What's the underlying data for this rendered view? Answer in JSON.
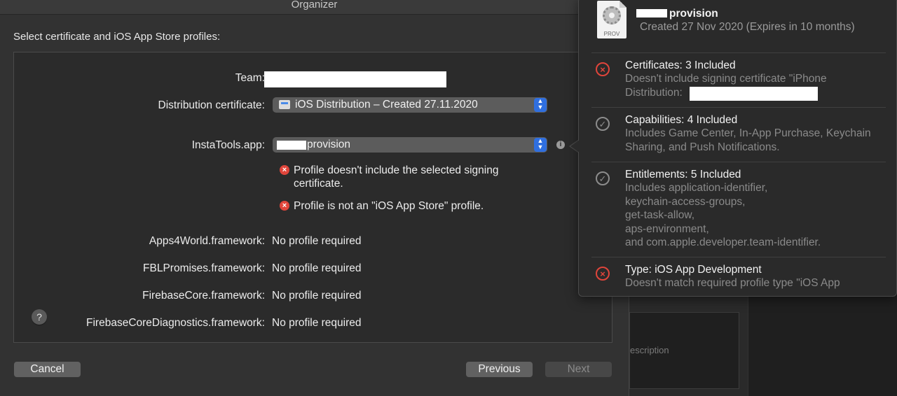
{
  "window": {
    "title": "Organizer"
  },
  "instruction": "Select certificate and iOS App Store profiles:",
  "form": {
    "team_label": "Team:",
    "distribution_label": "Distribution certificate:",
    "distribution_value": "iOS Distribution – Created 27.11.2020",
    "app_label": "InstaTools.app:",
    "app_profile_value": "provision",
    "errors": [
      "Profile doesn't include the selected signing certificate.",
      "Profile is not an \"iOS App Store\" profile."
    ],
    "frameworks": [
      {
        "label": "Apps4World.framework:",
        "value": "No profile required"
      },
      {
        "label": "FBLPromises.framework:",
        "value": "No profile required"
      },
      {
        "label": "FirebaseCore.framework:",
        "value": "No profile required"
      },
      {
        "label": "FirebaseCoreDiagnostics.framework:",
        "value": "No profile required"
      }
    ]
  },
  "help": {
    "label": "?"
  },
  "buttons": {
    "cancel": "Cancel",
    "previous": "Previous",
    "next": "Next"
  },
  "background": {
    "panel_text": "escription"
  },
  "popover": {
    "icon_label": "PROV",
    "title": "provision",
    "subtitle": "Created 27 Nov 2020 (Expires in 10 months)",
    "sections": [
      {
        "title": "Certificates: 3 Included",
        "body": "Doesn't include signing certificate \"iPhone Distribution:",
        "status": "bad"
      },
      {
        "title": "Capabilities: 4 Included",
        "body": "Includes Game Center, In-App Purchase, Keychain Sharing, and Push Notifications.",
        "status": "ok"
      },
      {
        "title": "Entitlements: 5 Included",
        "body": "Includes application-identifier,\nkeychain-access-groups,\nget-task-allow,\naps-environment,\nand com.apple.developer.team-identifier.",
        "status": "ok"
      },
      {
        "title": "Type: iOS App Development",
        "body": "Doesn't match required profile type \"iOS App",
        "status": "bad"
      }
    ]
  },
  "colors": {
    "accent": "#2f6fe0",
    "error": "#e0453b"
  }
}
